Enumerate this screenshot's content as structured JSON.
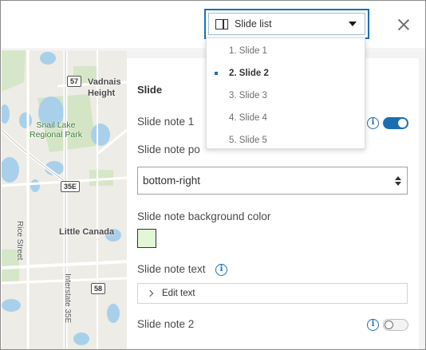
{
  "header": {
    "slide_selector": {
      "label": "Slide list"
    }
  },
  "dropdown": {
    "items": [
      {
        "label": "1. Slide 1",
        "selected": false
      },
      {
        "label": "2. Slide 2",
        "selected": true
      },
      {
        "label": "3. Slide 3",
        "selected": false
      },
      {
        "label": "4. Slide 4",
        "selected": false
      },
      {
        "label": "5. Slide 5",
        "selected": false
      }
    ]
  },
  "map": {
    "labels": {
      "vadnais": "Vadnais",
      "heights": "Height",
      "park": "Snail Lake\nRegional Park",
      "little_canada": "Little Canada",
      "rice_street": "Rice Street",
      "interstate": "Interstate 35E"
    },
    "shields": {
      "s57": "57",
      "s35e": "35E",
      "s58": "58"
    }
  },
  "panel": {
    "section_title": "Slide",
    "slide_note_1": {
      "label": "Slide note 1",
      "enabled": true
    },
    "position": {
      "label": "Slide note po",
      "value": "bottom-right"
    },
    "background": {
      "label": "Slide note background color",
      "color": "#e2f7d6"
    },
    "text": {
      "label": "Slide note text",
      "edit_label": "Edit text"
    },
    "slide_note_2": {
      "label": "Slide note 2",
      "enabled": false
    }
  },
  "colors": {
    "accent": "#1b6fb0",
    "water": "#a8d0ea",
    "park": "#cfe3c0"
  }
}
